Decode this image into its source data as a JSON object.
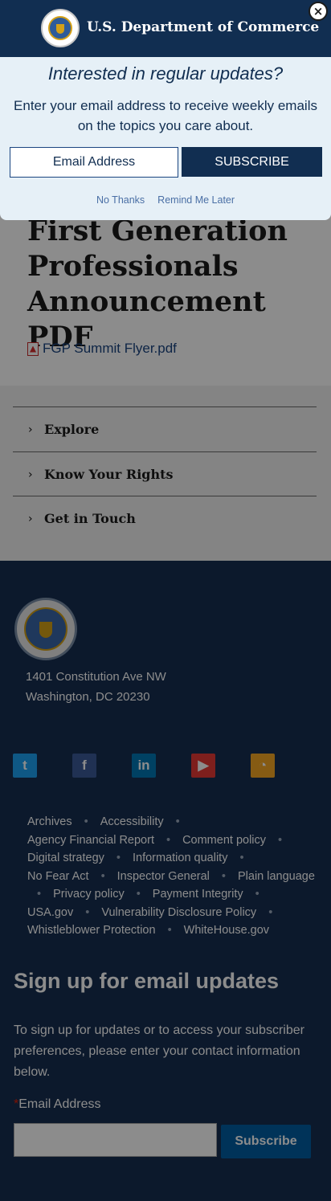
{
  "page": {
    "title": "First Generation Professionals Announcement PDF",
    "attachment": "FGP Summit Flyer.pdf"
  },
  "accordion": {
    "items": [
      {
        "label": "Explore"
      },
      {
        "label": "Know Your Rights"
      },
      {
        "label": "Get in Touch"
      }
    ]
  },
  "footer": {
    "address_line1": "1401 Constitution Ave NW",
    "address_line2": "Washington, DC 20230",
    "social_icons": [
      "twitter-icon",
      "facebook-icon",
      "linkedin-icon",
      "youtube-icon",
      "rss-icon"
    ],
    "links": [
      [
        "Archives",
        "Accessibility"
      ],
      [
        "Agency Financial Report",
        "Comment policy"
      ],
      [
        "Digital strategy",
        "Information quality"
      ],
      [
        "No Fear Act",
        "Inspector General",
        "Plain language"
      ],
      [
        "Privacy policy",
        "Payment Integrity"
      ],
      [
        "USA.gov",
        "Vulnerability Disclosure Policy"
      ],
      [
        "Whistleblower Protection",
        "WhiteHouse.gov"
      ]
    ]
  },
  "signup": {
    "title": "Sign up for email updates",
    "description": "To sign up for updates or to access your subscriber preferences, please enter your contact information below.",
    "email_label": "Email Address",
    "required_mark": "*",
    "subscribe_label": "Subscribe"
  },
  "modal": {
    "header_title": "U.S. Department of Commerce",
    "close_glyph": "×",
    "heading": "Interested in regular updates?",
    "subtext": "Enter your email address to receive weekly emails on the topics you care about.",
    "email_placeholder": "Email Address",
    "subscribe_label": "SUBSCRIBE",
    "no_thanks": "No Thanks",
    "remind_later": "Remind Me Later"
  },
  "colors": {
    "navy": "#112e51",
    "footer_bg": "#162e51",
    "modal_bg": "#e6f0f7",
    "link_blue": "#1a4480",
    "button_blue": "#005ea2"
  }
}
